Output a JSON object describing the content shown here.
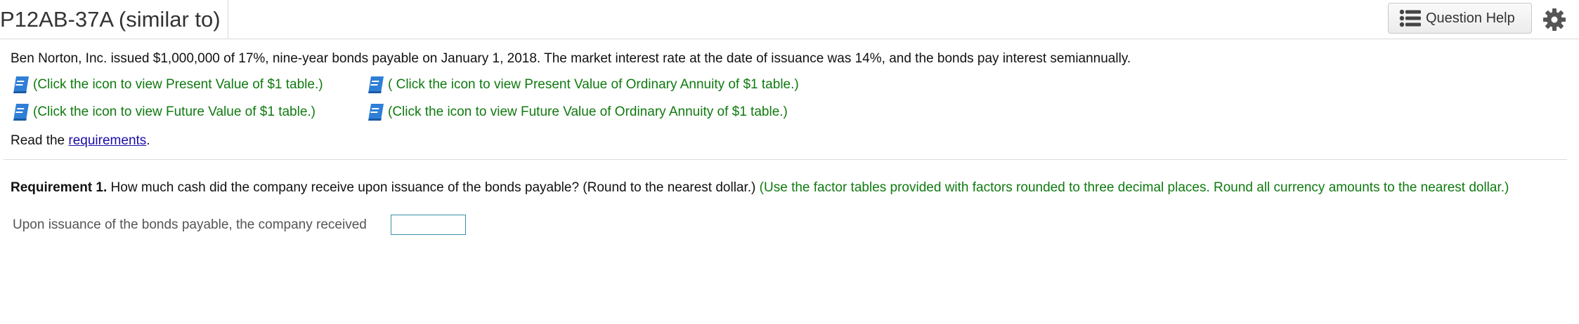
{
  "header": {
    "title": "P12AB-37A (similar to)",
    "question_help_label": "Question Help",
    "question_help_icon": "list-icon",
    "settings_icon": "gear-icon"
  },
  "problem": {
    "intro": "Ben Norton, Inc. issued $1,000,000 of 17%, nine-year bonds payable on January 1, 2018. The market interest rate at the date of issuance was 14%, and the bonds pay interest semiannually.",
    "table_links": [
      {
        "label": "(Click the icon to view Present Value of $1 table.)",
        "icon": "book-icon"
      },
      {
        "label": "( Click the icon to view Present Value of Ordinary Annuity of $1 table.)",
        "icon": "book-icon"
      },
      {
        "label": "(Click the icon to view Future Value of $1 table.)",
        "icon": "book-icon"
      },
      {
        "label": "(Click the icon to view Future Value of Ordinary Annuity of $1 table.)",
        "icon": "book-icon"
      }
    ],
    "read_prefix": "Read the ",
    "requirements_link": "requirements",
    "read_suffix": "."
  },
  "requirement1": {
    "label": "Requirement 1.",
    "question": " How much cash did the company receive upon issuance of the bonds payable? (Round to the nearest dollar.) ",
    "note": "(Use the factor tables provided with factors rounded to three decimal places. Round all currency amounts to the nearest dollar.)",
    "answer_prompt": "Upon issuance of the bonds payable, the company received",
    "answer_value": ""
  },
  "colors": {
    "link_green": "#0f7a0f",
    "link_blue": "#1a0dab",
    "input_border": "#3a8ea6",
    "book_blue": "#2f7fd6"
  }
}
